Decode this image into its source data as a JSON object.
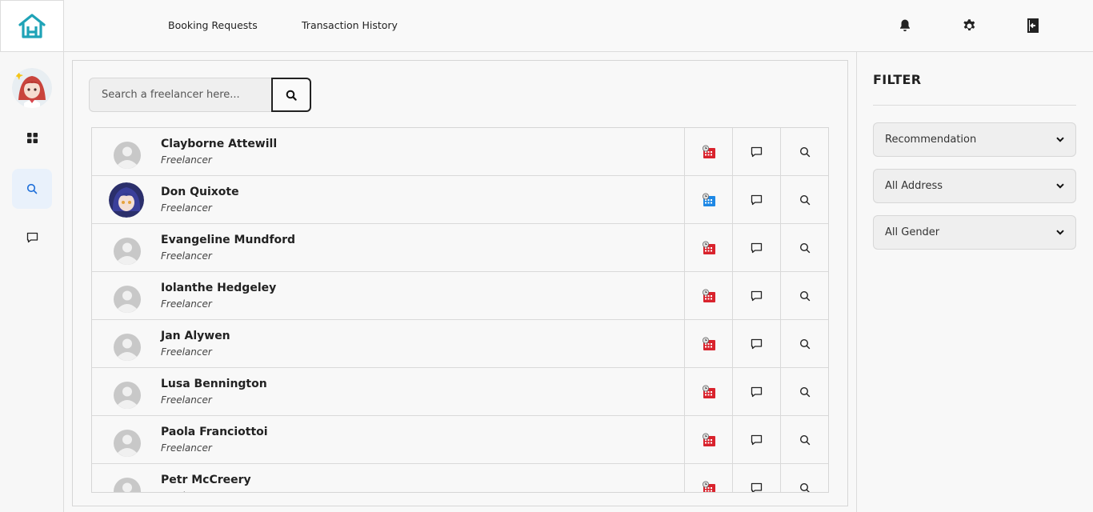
{
  "header": {
    "nav": {
      "booking_requests": "Booking Requests",
      "transaction_history": "Transaction History"
    },
    "icons": [
      "bell-icon",
      "gear-icon",
      "logout-icon"
    ]
  },
  "sidebar": {
    "items": [
      "dashboard-icon",
      "search-icon",
      "chat-icon"
    ],
    "active": "search"
  },
  "search": {
    "placeholder": "Search a freelancer here..."
  },
  "freelancers": [
    {
      "name": "Clayborne Attewill",
      "role": "Freelancer",
      "avatar": "default",
      "calendar": "red"
    },
    {
      "name": "Don Quixote",
      "role": "Freelancer",
      "avatar": "photo",
      "calendar": "blue"
    },
    {
      "name": "Evangeline Mundford",
      "role": "Freelancer",
      "avatar": "default",
      "calendar": "red"
    },
    {
      "name": "Iolanthe Hedgeley",
      "role": "Freelancer",
      "avatar": "default",
      "calendar": "red"
    },
    {
      "name": "Jan Alywen",
      "role": "Freelancer",
      "avatar": "default",
      "calendar": "red"
    },
    {
      "name": "Lusa Bennington",
      "role": "Freelancer",
      "avatar": "default",
      "calendar": "red"
    },
    {
      "name": "Paola Franciottoi",
      "role": "Freelancer",
      "avatar": "default",
      "calendar": "red"
    },
    {
      "name": "Petr McCreery",
      "role": "Freelancer",
      "avatar": "default",
      "calendar": "red"
    }
  ],
  "filter": {
    "title": "FILTER",
    "sort": "Recommendation",
    "address": "All Address",
    "gender": "All Gender"
  },
  "colors": {
    "accent_teal": "#1fa3b7",
    "active_bg": "#e9f1fb",
    "calendar_red": "#d9232d",
    "calendar_blue": "#1e88e5"
  }
}
